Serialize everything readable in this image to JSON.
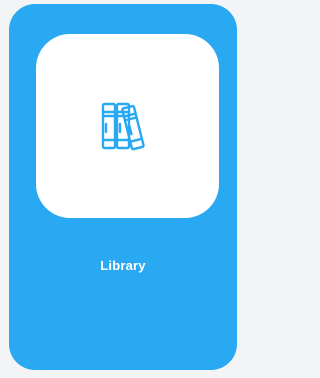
{
  "tile": {
    "label": "Library",
    "icon": "books-icon",
    "colors": {
      "tile_background": "#2aa9f3",
      "icon_background": "#ffffff",
      "icon_stroke": "#2aa9f3",
      "label_color": "#ffffff",
      "page_background": "#f3f4f5"
    }
  }
}
